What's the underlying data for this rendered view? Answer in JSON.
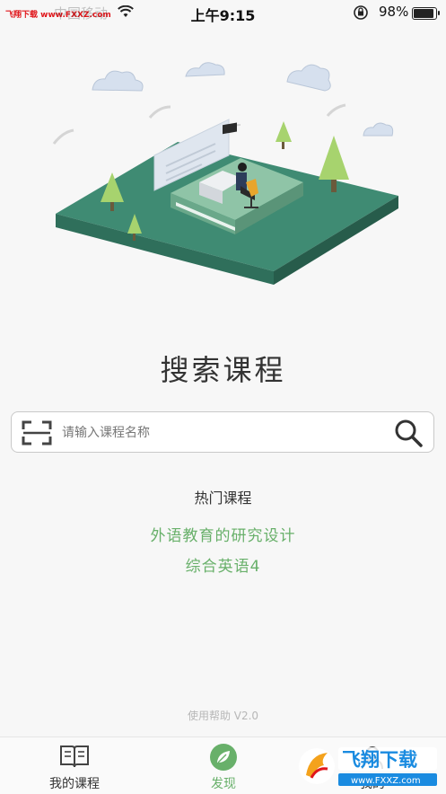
{
  "status_bar": {
    "watermark": "飞翔下载 www.FXXZ.com",
    "carrier": "中国移动",
    "time": "上午9:15",
    "battery": "98%",
    "battery_level": 0.98
  },
  "main": {
    "title": "搜索课程",
    "search": {
      "placeholder": "请输入课程名称"
    },
    "hot_title": "热门课程",
    "hot_courses": [
      "外语教育的研究设计",
      "综合英语4"
    ],
    "help": "使用帮助 V2.0"
  },
  "tabs": [
    {
      "label": "我的课程",
      "icon": "book-icon"
    },
    {
      "label": "发现",
      "icon": "leaf-icon",
      "active": true
    },
    {
      "label": "我的",
      "icon": "user-icon"
    }
  ],
  "watermark_bottom": {
    "brand": "飞翔下载",
    "url": "www.FXXZ.com"
  },
  "colors": {
    "accent": "#68b06a",
    "platform": "#3e8a72",
    "tree": "#9ccf6d"
  }
}
